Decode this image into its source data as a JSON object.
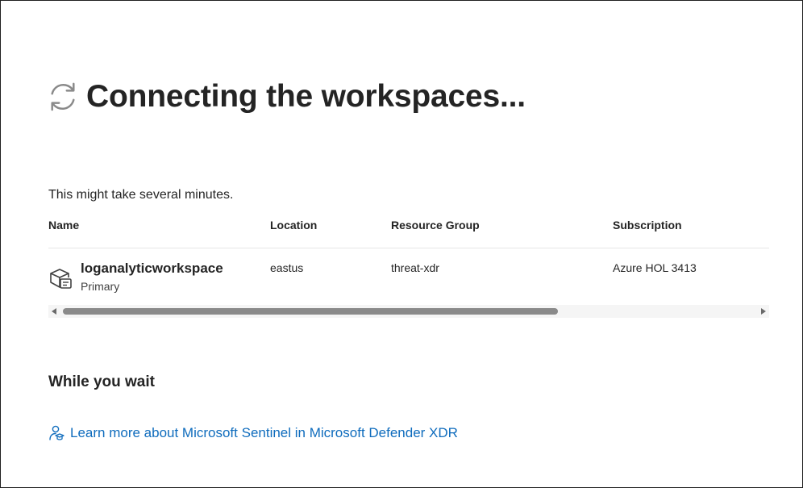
{
  "header": {
    "icon": "refresh-icon",
    "title": "Connecting the workspaces..."
  },
  "subtitle": "This might take several minutes.",
  "table": {
    "columns": [
      "Name",
      "Location",
      "Resource Group",
      "Subscription"
    ],
    "rows": [
      {
        "icon": "workspace-icon",
        "name": "loganalyticworkspace",
        "tag": "Primary",
        "location": "eastus",
        "resource_group": "threat-xdr",
        "subscription": "Azure HOL 3413"
      }
    ]
  },
  "while_you_wait": {
    "heading": "While you wait",
    "link_icon": "learning-person-icon",
    "link_text": "Learn more about Microsoft Sentinel in Microsoft Defender XDR"
  },
  "colors": {
    "link": "#0f6cbd",
    "text": "#242424",
    "icon_gray": "#8a8a8a"
  }
}
